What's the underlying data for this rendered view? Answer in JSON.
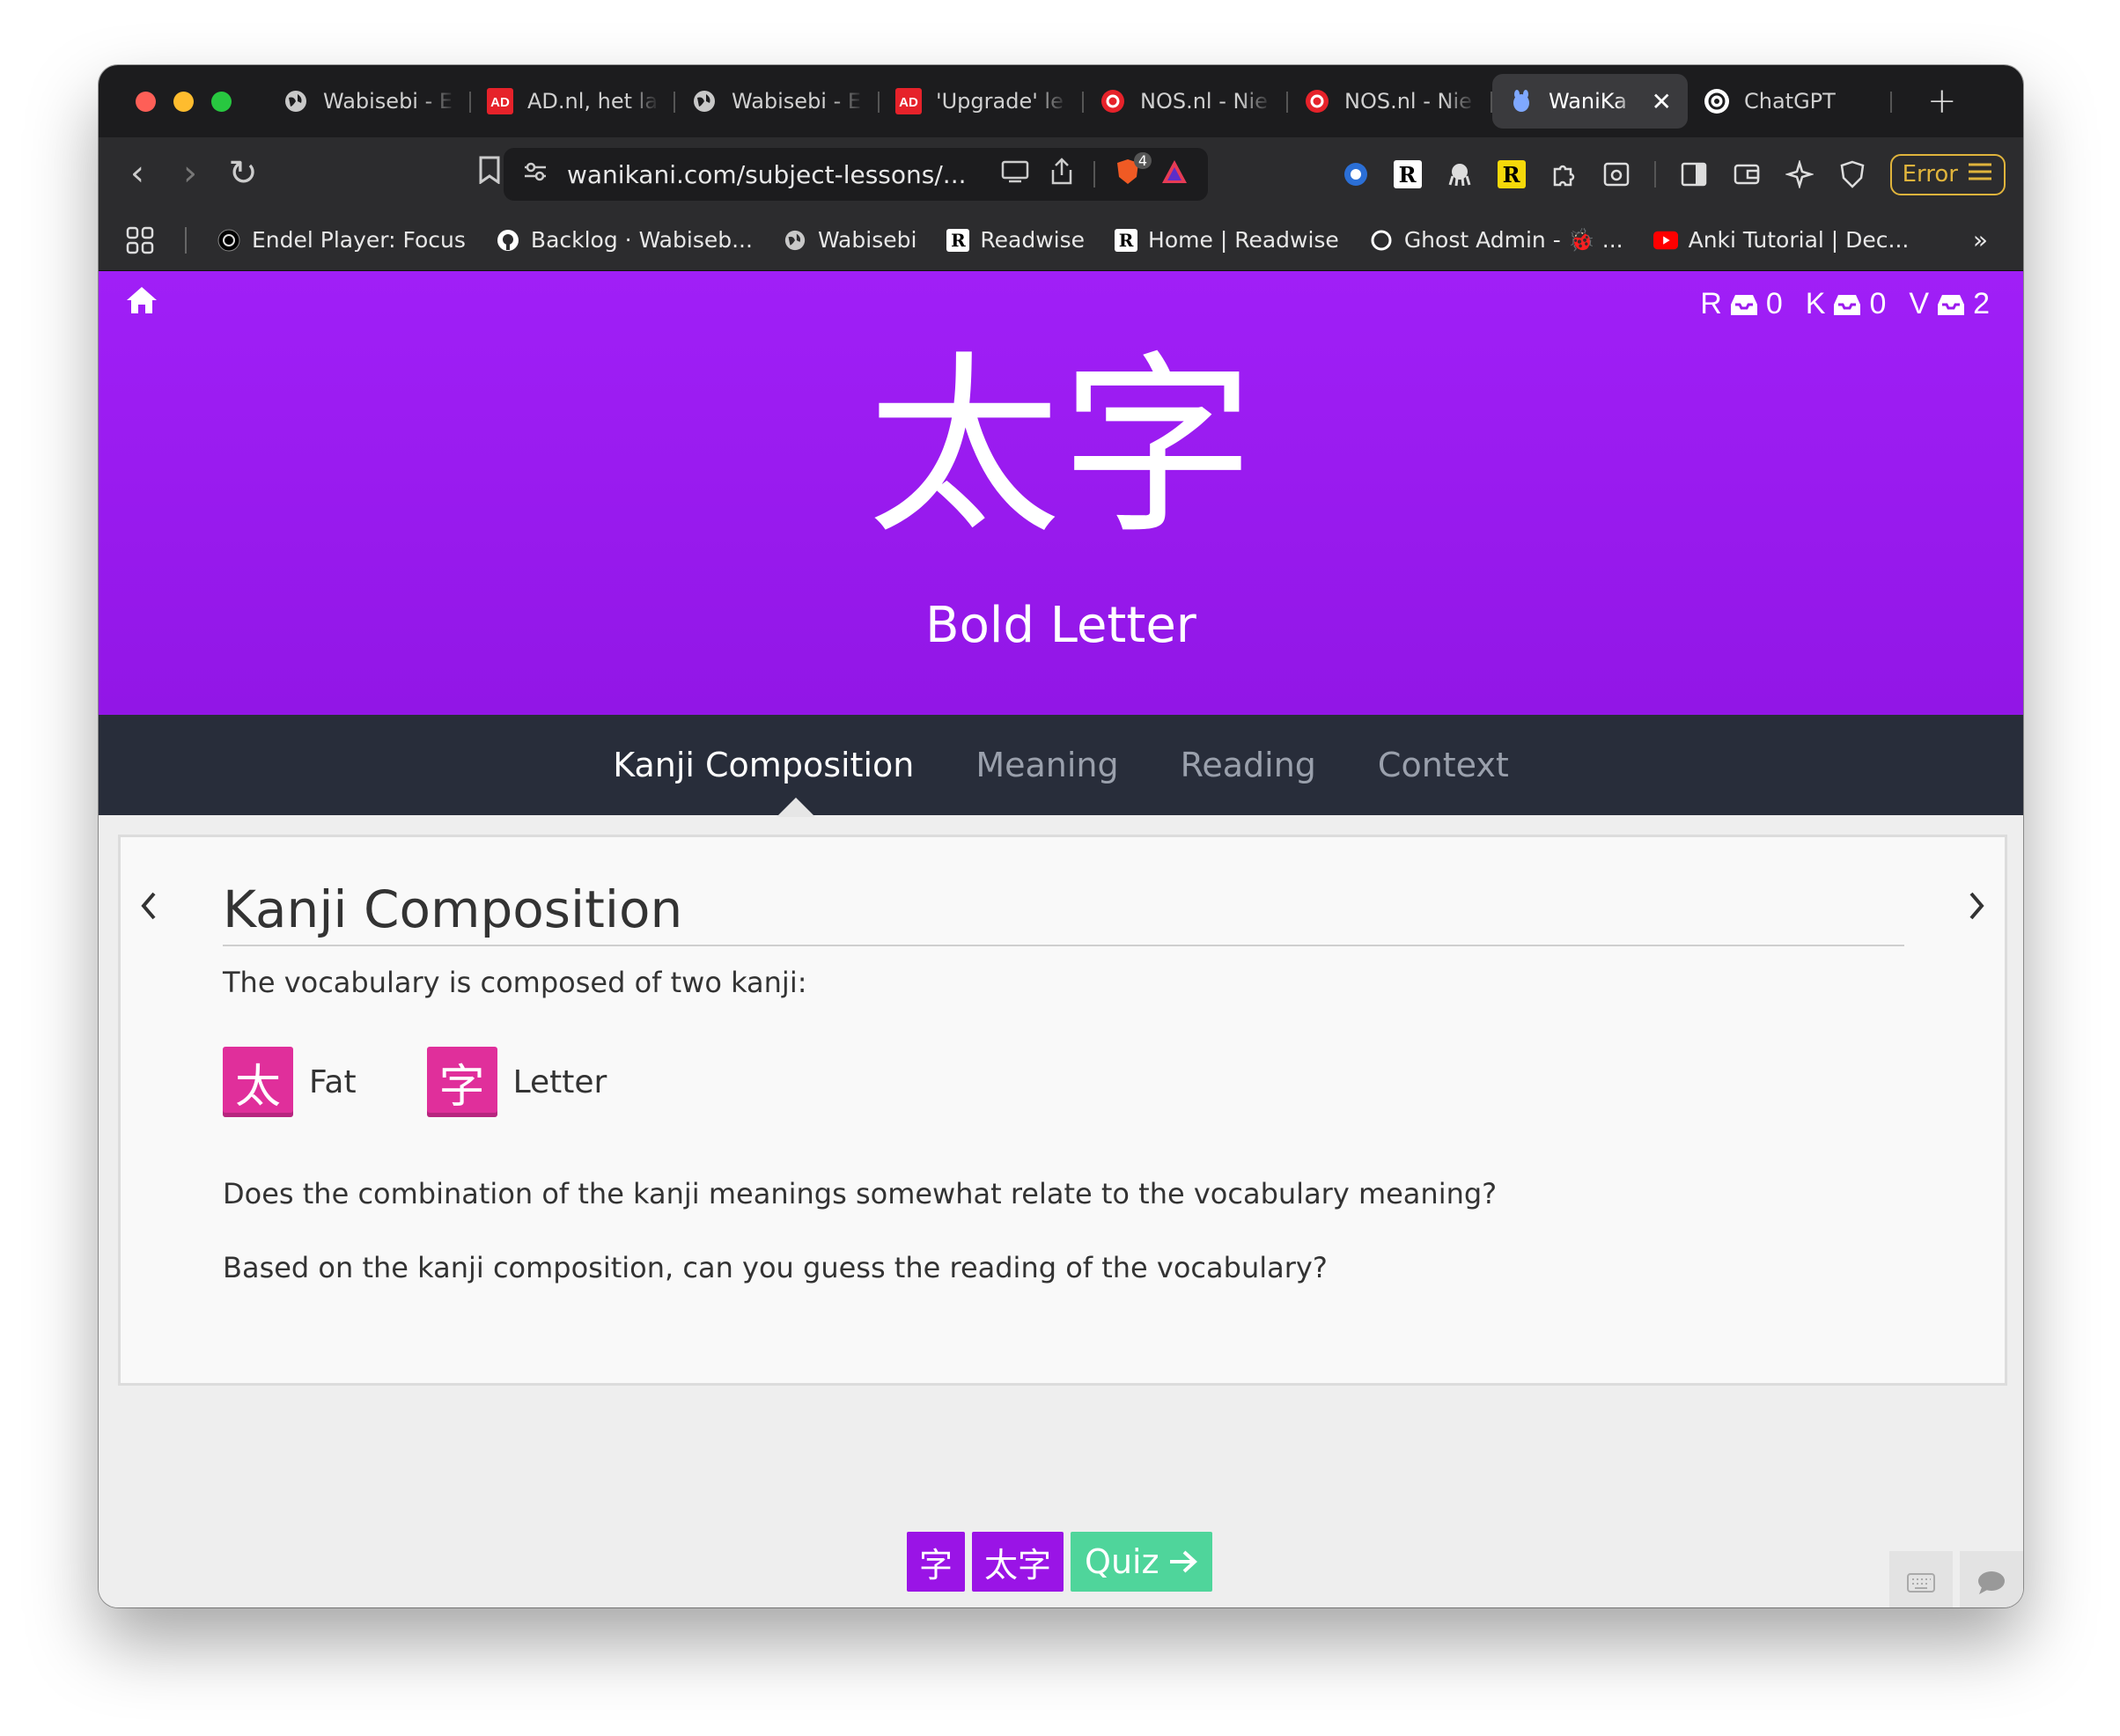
{
  "tabs": [
    {
      "title": "Wabisebi - E",
      "icon": "globe-icon"
    },
    {
      "title": "AD.nl, het la",
      "icon": "ad-icon"
    },
    {
      "title": "Wabisebi - E",
      "icon": "globe-icon"
    },
    {
      "title": "'Upgrade' le",
      "icon": "ad-icon"
    },
    {
      "title": "NOS.nl - Nie",
      "icon": "nos-icon"
    },
    {
      "title": "NOS.nl - Nie",
      "icon": "nos-icon"
    },
    {
      "title": "WaniKa",
      "icon": "wanikani-icon",
      "active": true
    },
    {
      "title": "ChatGPT",
      "icon": "chatgpt-icon"
    }
  ],
  "nav": {
    "url": "wanikani.com/subject-lessons/...",
    "shield_badge": "4",
    "error_label": "Error"
  },
  "bookmarks": [
    {
      "label": "Endel Player: Focus"
    },
    {
      "label": "Backlog · Wabiseb..."
    },
    {
      "label": "Wabisebi"
    },
    {
      "label": "Readwise"
    },
    {
      "label": "Home | Readwise"
    },
    {
      "label": "Ghost Admin - 🐞 ..."
    },
    {
      "label": "Anki Tutorial | Dec..."
    }
  ],
  "queue": {
    "r_letter": "R",
    "r_count": "0",
    "k_letter": "K",
    "k_count": "0",
    "v_letter": "V",
    "v_count": "2"
  },
  "subject": {
    "characters": "太字",
    "meaning": "Bold Letter"
  },
  "subnav": [
    "Kanji Composition",
    "Meaning",
    "Reading",
    "Context"
  ],
  "card": {
    "title": "Kanji Composition",
    "intro": "The vocabulary is composed of two kanji:",
    "kanji": [
      {
        "char": "太",
        "meaning": "Fat"
      },
      {
        "char": "字",
        "meaning": "Letter"
      }
    ],
    "question1": "Does the combination of the kanji meanings somewhat relate to the vocabulary meaning?",
    "question2": "Based on the kanji composition, can you guess the reading of the vocabulary?"
  },
  "bottom": {
    "item1": "字",
    "item2": "太字",
    "quiz_label": "Quiz"
  },
  "colors": {
    "header_purple": "#a01ff7",
    "kanji_pink": "#e02f9b",
    "quiz_green": "#4fd59b",
    "subnav_bg": "#282d3a"
  }
}
